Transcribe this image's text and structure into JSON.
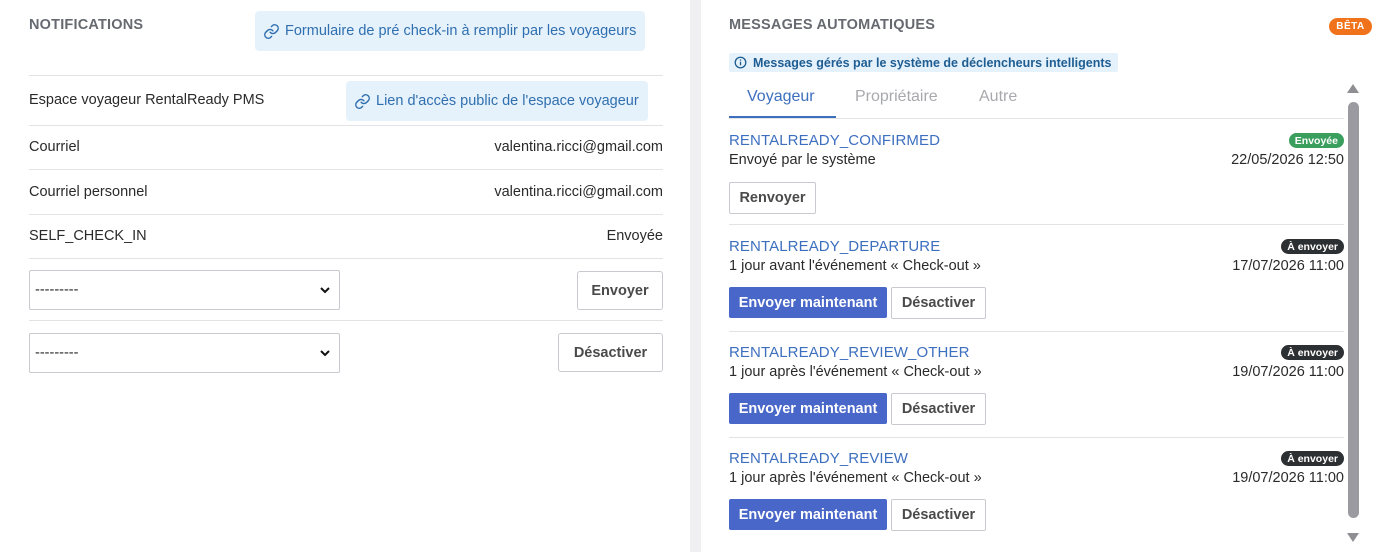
{
  "notifications": {
    "title": "NOTIFICATIONS",
    "precheckin_link": "Formulaire de pré check-in à remplir par les voyageurs",
    "rows": [
      {
        "label": "Espace voyageur RentalReady PMS",
        "link": "Lien d'accès public de l'espace voyageur"
      },
      {
        "label": "Courriel",
        "value": "valentina.ricci@gmail.com"
      },
      {
        "label": "Courriel personnel",
        "value": "valentina.ricci@gmail.com"
      },
      {
        "label": "SELF_CHECK_IN",
        "value": "Envoyée"
      }
    ],
    "select1": {
      "value": "---------",
      "button": "Envoyer"
    },
    "select2": {
      "value": "---------",
      "button": "Désactiver"
    }
  },
  "auto_messages": {
    "title": "MESSAGES AUTOMATIQUES",
    "beta": "BÊTA",
    "info": "Messages gérés par le système de déclencheurs intelligents",
    "tabs": [
      {
        "label": "Voyageur",
        "active": true
      },
      {
        "label": "Propriétaire",
        "active": false
      },
      {
        "label": "Autre",
        "active": false
      }
    ],
    "messages": [
      {
        "name": "RENTALREADY_CONFIRMED",
        "status": "Envoyée",
        "status_type": "sent",
        "description": "Envoyé par le système",
        "date": "22/05/2026 12:50",
        "resend_label": "Renvoyer"
      },
      {
        "name": "RENTALREADY_DEPARTURE",
        "status": "À envoyer",
        "status_type": "todo",
        "description": "1 jour avant l'événement « Check-out »",
        "date": "17/07/2026 11:00",
        "send_now_label": "Envoyer maintenant",
        "disable_label": "Désactiver"
      },
      {
        "name": "RENTALREADY_REVIEW_OTHER",
        "status": "À envoyer",
        "status_type": "todo",
        "description": "1 jour après l'événement « Check-out »",
        "date": "19/07/2026 11:00",
        "send_now_label": "Envoyer maintenant",
        "disable_label": "Désactiver"
      },
      {
        "name": "RENTALREADY_REVIEW",
        "status": "À envoyer",
        "status_type": "todo",
        "description": "1 jour après l'événement « Check-out »",
        "date": "19/07/2026 11:00",
        "send_now_label": "Envoyer maintenant",
        "disable_label": "Désactiver"
      }
    ]
  },
  "colors": {
    "accent": "#3d6fbf",
    "primary_button": "#4867c9",
    "badge_sent": "#3a9e5d",
    "badge_todo": "#2d3033",
    "beta": "#f0731b",
    "link_chip_bg": "#e6f2fb"
  },
  "icons": [
    "link-icon",
    "info-icon",
    "chevron-down-icon",
    "scroll-up-arrow",
    "scroll-down-arrow"
  ]
}
